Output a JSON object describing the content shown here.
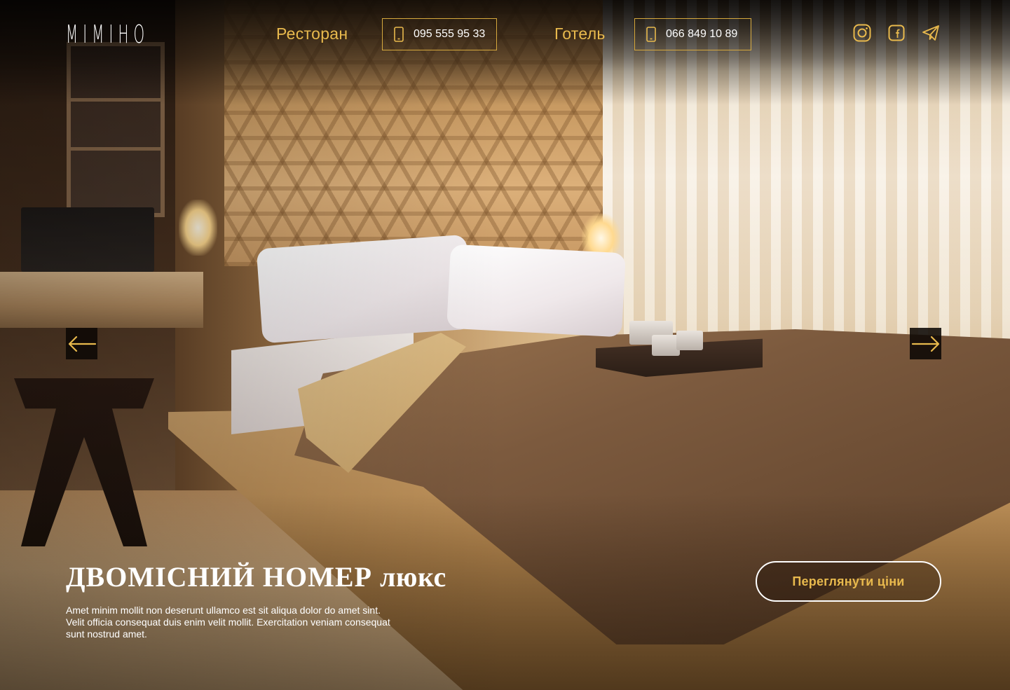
{
  "header": {
    "logo_text": "MIMIHO",
    "nav": [
      {
        "label": "Ресторан",
        "phone": "095 555 95 33"
      },
      {
        "label": "Готель",
        "phone": "066 849 10 89"
      }
    ],
    "social_icons": [
      "instagram-icon",
      "facebook-icon",
      "telegram-icon"
    ]
  },
  "slider": {
    "prev_icon": "arrow-left-icon",
    "next_icon": "arrow-right-icon"
  },
  "hero": {
    "title_main": "ДВОМІСНИЙ НОМЕР",
    "title_suffix": "люкс",
    "description": "Amet minim mollit non deserunt ullamco est sit aliqua dolor do amet sint. Velit officia consequat duis enim velit mollit. Exercitation veniam consequat sunt nostrud amet.",
    "cta_label": "Переглянути ціни"
  },
  "colors": {
    "accent": "#e8b94d",
    "border_accent": "#d6a93e",
    "text": "#ffffff",
    "arrow_bg": "#0c0805"
  }
}
